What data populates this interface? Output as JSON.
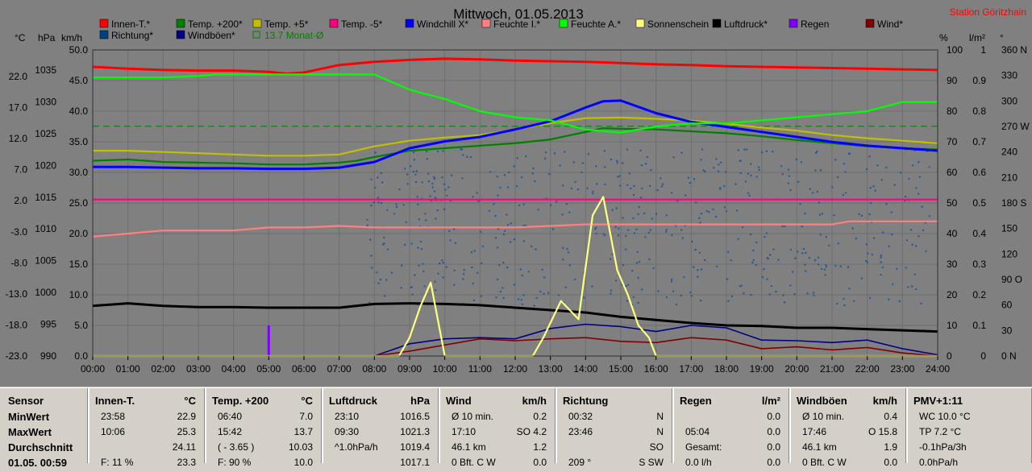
{
  "header": {
    "title": "Mittwoch, 01.05.2013",
    "station": "Station Göritzhain"
  },
  "legend": [
    {
      "label": "Innen-T.*",
      "color": "#ff0000"
    },
    {
      "label": "Temp. +200*",
      "color": "#008000"
    },
    {
      "label": "Temp. +5*",
      "color": "#c0c000"
    },
    {
      "label": "Temp. -5*",
      "color": "#ff0080"
    },
    {
      "label": "Windchill X*",
      "color": "#0000ff"
    },
    {
      "label": "Feuchte I.*",
      "color": "#ff8080"
    },
    {
      "label": "Feuchte A.*",
      "color": "#00ff00"
    },
    {
      "label": "Sonnenschein",
      "color": "#ffff80"
    },
    {
      "label": "Luftdruck*",
      "color": "#000000"
    },
    {
      "label": "Regen",
      "color": "#8000ff"
    },
    {
      "label": "Wind*",
      "color": "#800000"
    },
    {
      "label": "Richtung*",
      "color": "#004080"
    },
    {
      "label": "Windböen*",
      "color": "#000080"
    },
    {
      "label": "13.7 Monat-Ø",
      "color": "#008000"
    }
  ],
  "axis_units": {
    "temp": "°C",
    "pressure": "hPa",
    "wind": "km/h",
    "humidity": "%",
    "rain": "l/m²",
    "direction": "°"
  },
  "chart_data": {
    "type": "line",
    "x_ticks": [
      "00:00",
      "01:00",
      "02:00",
      "03:00",
      "04:00",
      "05:00",
      "06:00",
      "07:00",
      "08:00",
      "09:00",
      "10:00",
      "11:00",
      "12:00",
      "13:00",
      "14:00",
      "15:00",
      "16:00",
      "17:00",
      "18:00",
      "19:00",
      "20:00",
      "21:00",
      "22:00",
      "23:00",
      "24:00"
    ],
    "temp_ticks": [
      "22.0",
      "17.0",
      "12.0",
      "7.0",
      "2.0",
      "-3.0",
      "-8.0",
      "-13.0",
      "-18.0",
      "-23.0"
    ],
    "pressure_ticks": [
      "1035",
      "1030",
      "1025",
      "1020",
      "1015",
      "1010",
      "1005",
      "1000",
      "995",
      "990"
    ],
    "wind_ticks": [
      "50.0",
      "45.0",
      "40.0",
      "35.0",
      "30.0",
      "25.0",
      "20.0",
      "15.0",
      "10.0",
      "5.0",
      "0.0"
    ],
    "humidity_ticks": [
      "100",
      "90",
      "80",
      "70",
      "60",
      "50",
      "40",
      "30",
      "20",
      "10",
      "0"
    ],
    "rain_ticks": [
      "1",
      "0.9",
      "0.8",
      "0.7",
      "0.6",
      "0.5",
      "0.4",
      "0.3",
      "0.2",
      "0.1",
      "0"
    ],
    "direction_ticks": [
      "360 N",
      "330",
      "300",
      "270 W",
      "240",
      "210",
      "180 S",
      "150",
      "120",
      "90 O",
      "60",
      "30",
      "0 N"
    ],
    "temp_range": [
      -23,
      25.9
    ],
    "wind_range": [
      0,
      50
    ],
    "humidity_range": [
      0,
      100
    ],
    "monthly_avg_temp": 13.7,
    "series": [
      {
        "name": "Innen-T.*",
        "color": "#ff0000",
        "x": [
          0,
          1,
          2,
          3,
          4,
          5,
          5.5,
          6,
          7,
          8,
          9,
          10,
          11,
          12,
          13,
          14,
          15,
          16,
          17,
          18,
          19,
          20,
          21,
          22,
          23,
          24
        ],
        "y": [
          23.2,
          22.9,
          22.7,
          22.6,
          22.6,
          22.4,
          22.1,
          22.3,
          23.5,
          24.0,
          24.3,
          24.5,
          24.4,
          24.2,
          24.1,
          24.0,
          23.8,
          23.6,
          23.5,
          23.3,
          23.2,
          23.1,
          23.0,
          22.9,
          22.8,
          22.7
        ]
      },
      {
        "name": "Temp. +200*",
        "color": "#008000",
        "x": [
          0,
          1,
          2,
          3,
          4,
          5,
          6,
          7,
          7.5,
          8,
          9,
          10,
          11,
          12,
          13,
          14,
          14.5,
          15,
          16,
          17,
          18,
          19,
          20,
          21,
          22,
          23,
          24
        ],
        "y": [
          8.2,
          8.4,
          8.0,
          7.9,
          7.8,
          7.6,
          7.6,
          7.9,
          8.2,
          8.8,
          9.8,
          10.2,
          10.6,
          11.0,
          11.6,
          12.8,
          13.4,
          13.3,
          13.2,
          12.9,
          12.6,
          12.1,
          11.5,
          11.0,
          10.5,
          10.2,
          10.0
        ]
      },
      {
        "name": "Temp. +5*",
        "color": "#c0c000",
        "x": [
          0,
          1,
          2,
          3,
          4,
          5,
          6,
          7,
          8,
          9,
          10,
          11,
          12,
          13,
          14,
          15,
          16,
          17,
          18,
          19,
          20,
          21,
          22,
          23,
          24
        ],
        "y": [
          9.8,
          9.8,
          9.6,
          9.4,
          9.2,
          9.0,
          9.0,
          9.2,
          10.5,
          11.4,
          11.9,
          12.3,
          13.2,
          14.2,
          15.0,
          15.1,
          14.9,
          14.6,
          14.1,
          13.5,
          13.0,
          12.3,
          11.8,
          11.4,
          11.0
        ]
      },
      {
        "name": "Temp. -5*",
        "color": "#ff0080",
        "x": [
          0,
          24
        ],
        "y": [
          2.0,
          2.0
        ]
      },
      {
        "name": "Windchill X*",
        "color": "#0000ff",
        "x": [
          0,
          1,
          2,
          3,
          4,
          5,
          6,
          7,
          8,
          9,
          10,
          11,
          12,
          13,
          14,
          14.5,
          15,
          16,
          17,
          18,
          19,
          20,
          21,
          22,
          23,
          24
        ],
        "y": [
          7.2,
          7.2,
          7.1,
          7.0,
          7.0,
          6.9,
          6.9,
          7.1,
          8.0,
          10.2,
          11.3,
          12.0,
          13.2,
          14.5,
          16.7,
          17.7,
          17.8,
          15.8,
          14.4,
          13.6,
          12.8,
          12.0,
          11.2,
          10.6,
          10.2,
          9.8
        ]
      },
      {
        "name": "Feuchte I.*",
        "color": "#ff8080",
        "x": [
          0,
          1,
          2,
          3,
          4,
          5,
          6,
          7,
          8,
          9,
          10,
          11,
          12,
          13,
          14,
          15,
          16,
          17,
          18,
          19,
          20,
          21,
          21.5,
          22,
          23,
          24
        ],
        "y": [
          39,
          40,
          41,
          41,
          41,
          42,
          42,
          42.5,
          42,
          42,
          42,
          42,
          42,
          42.5,
          43,
          43,
          43,
          43,
          43,
          43,
          43,
          43,
          44,
          44,
          44,
          44
        ]
      },
      {
        "name": "Feuchte A.*",
        "color": "#00ff00",
        "x": [
          0,
          1,
          2,
          3,
          3.5,
          4,
          5,
          6,
          7,
          8,
          9,
          10,
          11,
          12,
          13,
          14,
          15,
          16,
          17,
          18,
          19,
          20,
          21,
          22,
          23,
          24
        ],
        "y": [
          91,
          91,
          91,
          91.5,
          92,
          92,
          92,
          92,
          92,
          92,
          87,
          84,
          80,
          78,
          77,
          74,
          73,
          75,
          76,
          76,
          77,
          78,
          79,
          80,
          83,
          83
        ]
      },
      {
        "name": "Luftdruck*",
        "color": "#000000",
        "x": [
          0,
          1,
          2,
          3,
          4,
          5,
          6,
          7,
          8,
          9,
          10,
          11,
          12,
          13,
          14,
          15,
          16,
          17,
          18,
          19,
          20,
          21,
          22,
          23,
          24
        ],
        "y": [
          8.2,
          8.6,
          8.2,
          8.0,
          8.0,
          7.9,
          7.9,
          7.9,
          8.5,
          8.6,
          8.5,
          8.3,
          7.9,
          7.5,
          7.1,
          6.4,
          5.9,
          5.4,
          5.0,
          4.9,
          4.6,
          4.6,
          4.4,
          4.2,
          4.0
        ]
      },
      {
        "name": "Sonnenschein",
        "color": "#ffff80",
        "x": [
          0,
          8.7,
          9.0,
          9.3,
          9.6,
          10,
          11,
          12,
          12.5,
          12.8,
          13.3,
          13.8,
          14.2,
          14.5,
          14.9,
          15.2,
          15.5,
          15.8,
          16,
          24
        ],
        "y": [
          0,
          0,
          3,
          8,
          12,
          0,
          0,
          0,
          0,
          3,
          9,
          6,
          23,
          26,
          14,
          10,
          5,
          3,
          0,
          0
        ]
      }
    ],
    "bottom_series": [
      {
        "name": "Windböen*",
        "color": "#000080",
        "x": [
          0,
          8,
          9,
          10,
          11,
          12,
          13,
          14,
          15,
          16,
          17,
          18,
          19,
          20,
          21,
          22,
          23,
          24
        ],
        "y": [
          0,
          0,
          2.0,
          2.8,
          3.0,
          2.8,
          4.5,
          5.2,
          4.8,
          4.0,
          5.0,
          4.6,
          2.6,
          2.5,
          2.2,
          2.6,
          1.2,
          0.2
        ]
      },
      {
        "name": "Wind*",
        "color": "#800000",
        "x": [
          0,
          8,
          9,
          10,
          11,
          12,
          13,
          14,
          15,
          16,
          17,
          18,
          19,
          20,
          21,
          22,
          23,
          24
        ],
        "y": [
          0,
          0,
          0.8,
          1.8,
          2.8,
          2.5,
          2.8,
          3.0,
          2.4,
          2.2,
          3.0,
          2.6,
          1.2,
          1.5,
          1.0,
          1.4,
          0.5,
          0.0
        ]
      }
    ],
    "rain_events": [
      {
        "x": 5.0,
        "value": 0.02
      }
    ]
  },
  "stats": {
    "row_labels": [
      "Sensor",
      "MinWert",
      "MaxWert",
      "Durchschnitt",
      "01.05. 00:59"
    ],
    "columns": [
      {
        "name": "Innen-T.",
        "unit": "°C",
        "rows": [
          [
            "23:58",
            "22.9"
          ],
          [
            "10:06",
            "25.3"
          ],
          [
            "",
            "24.11"
          ],
          [
            "F: 11 %",
            "23.3"
          ]
        ]
      },
      {
        "name": "Temp. +200",
        "unit": "°C",
        "rows": [
          [
            "06:40",
            "7.0"
          ],
          [
            "15:42",
            "13.7"
          ],
          [
            "( - 3.65 )",
            "10.03"
          ],
          [
            "F: 90 %",
            "10.0"
          ]
        ]
      },
      {
        "name": "Luftdruck",
        "unit": "hPa",
        "rows": [
          [
            "23:10",
            "1016.5"
          ],
          [
            "09:30",
            "1021.3"
          ],
          [
            "^1.0hPa/h",
            "1019.4"
          ],
          [
            "",
            "1017.1"
          ]
        ]
      },
      {
        "name": "Wind",
        "unit": "km/h",
        "rows": [
          [
            "Ø 10 min.",
            "0.2"
          ],
          [
            "17:10",
            "SO 4.2"
          ],
          [
            "46.1 km",
            "1.2"
          ],
          [
            "0 Bft. C W",
            "0.0"
          ]
        ]
      },
      {
        "name": "Richtung",
        "unit": "",
        "rows": [
          [
            "00:32",
            "N"
          ],
          [
            "23:46",
            "N"
          ],
          [
            "",
            "SO"
          ],
          [
            "209 °",
            "S SW"
          ]
        ]
      },
      {
        "name": "Regen",
        "unit": "l/m²",
        "rows": [
          [
            "",
            "0.0"
          ],
          [
            "05:04",
            "0.0"
          ],
          [
            "Gesamt:",
            "0.0"
          ],
          [
            "0.0 l/h",
            "0.0"
          ]
        ]
      },
      {
        "name": "Windböen",
        "unit": "km/h",
        "rows": [
          [
            "Ø 10 min.",
            "0.4"
          ],
          [
            "17:46",
            "O 15.8"
          ],
          [
            "46.1 km",
            "1.9"
          ],
          [
            "0 Bft. C W",
            "0.0"
          ]
        ]
      },
      {
        "name": "PMV+1:11",
        "unit": "",
        "rows": [
          [
            "WC 10.0 °C",
            ""
          ],
          [
            "TP 7.2 °C",
            ""
          ],
          [
            "-0.1hPa/3h",
            ""
          ],
          [
            "0.0hPa/h",
            ""
          ]
        ]
      }
    ]
  }
}
